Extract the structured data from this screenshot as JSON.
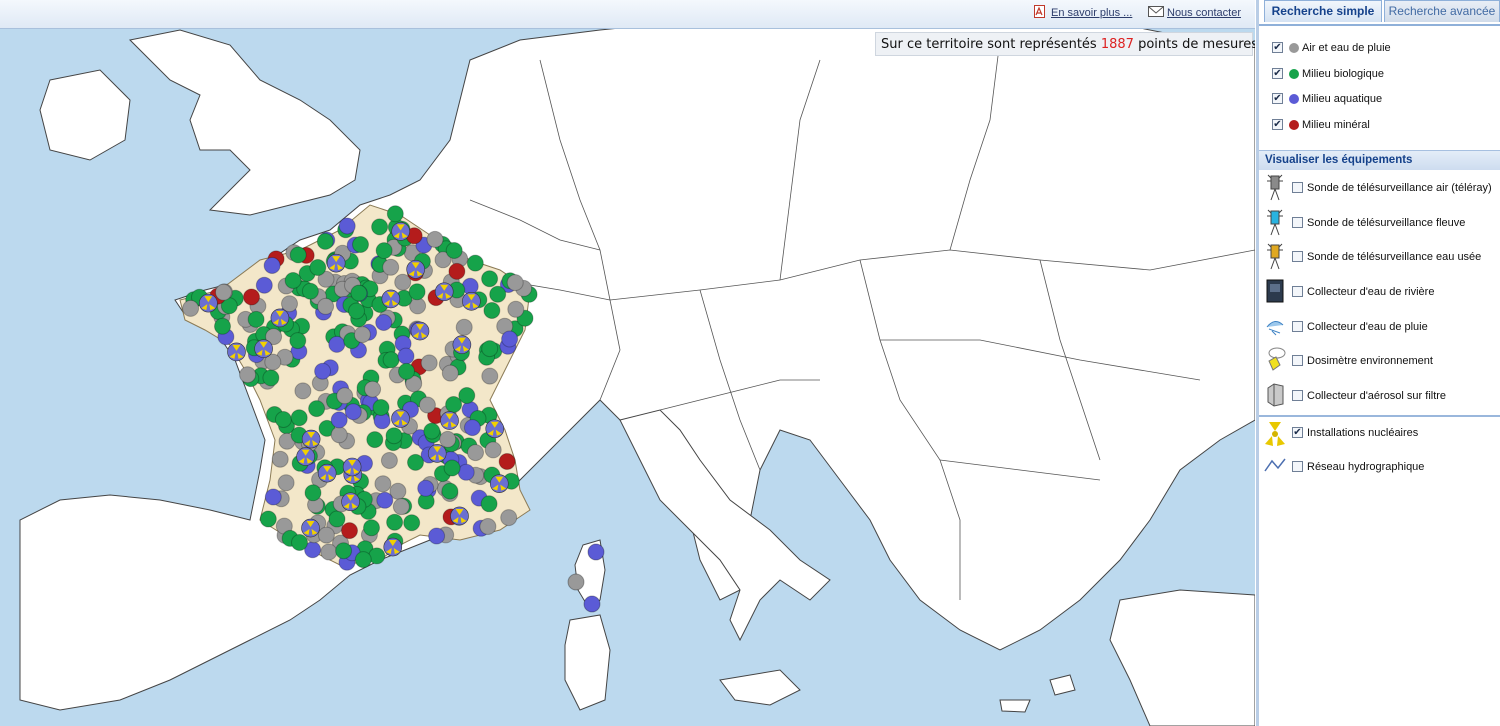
{
  "header": {
    "info_link": "En savoir plus ...",
    "contact_link": "Nous contacter"
  },
  "counter": {
    "prefix": "Sur ce territoire sont représentés",
    "count": "1887",
    "suffix": "points de mesures"
  },
  "tabs": [
    {
      "label": "Recherche simple",
      "active": true
    },
    {
      "label": "Recherche avancée",
      "active": false
    }
  ],
  "media_filters": [
    {
      "label": "Air et eau de pluie",
      "color": "#999999",
      "checked": true
    },
    {
      "label": "Milieu biologique",
      "color": "#16a34a",
      "checked": true
    },
    {
      "label": "Milieu aquatique",
      "color": "#5b5bd6",
      "checked": true
    },
    {
      "label": "Milieu minéral",
      "color": "#b41c1c",
      "checked": true
    }
  ],
  "equipment_section": {
    "title": "Visualiser les équipements",
    "items": [
      {
        "label": "Sonde de télésurveillance air (téléray)",
        "icon": "air-probe-icon",
        "checked": false
      },
      {
        "label": "Sonde de télésurveillance fleuve",
        "icon": "river-probe-icon",
        "checked": false
      },
      {
        "label": "Sonde de télésurveillance eau usée",
        "icon": "wastewater-probe-icon",
        "checked": false
      },
      {
        "label": "Collecteur d'eau de rivière",
        "icon": "river-collector-icon",
        "checked": false
      },
      {
        "label": "Collecteur d'eau de pluie",
        "icon": "rain-collector-icon",
        "checked": false
      },
      {
        "label": "Dosimètre environnement",
        "icon": "dosimeter-icon",
        "checked": false
      },
      {
        "label": "Collecteur d'aérosol sur filtre",
        "icon": "aerosol-collector-icon",
        "checked": false
      }
    ]
  },
  "layers": [
    {
      "label": "Installations nucléaires",
      "icon": "nuclear-icon",
      "checked": true
    },
    {
      "label": "Réseau hydrographique",
      "icon": "river-network-icon",
      "checked": false
    }
  ]
}
